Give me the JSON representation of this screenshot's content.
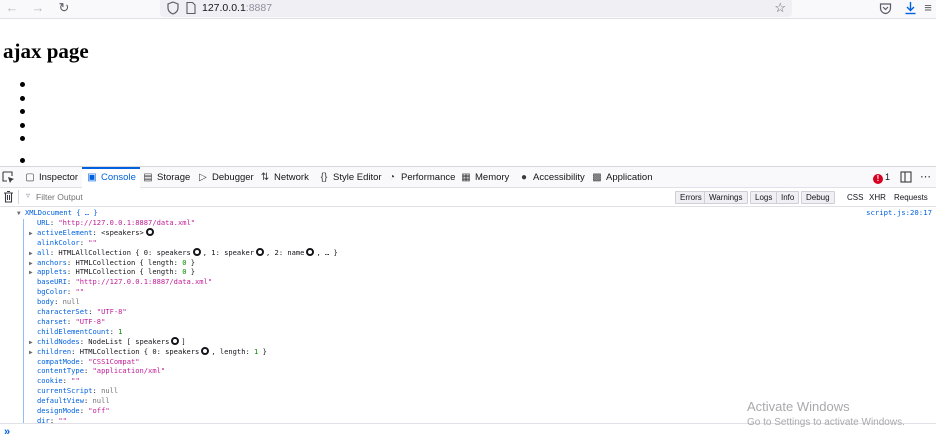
{
  "browser": {
    "url_host": "127.0.0.1",
    "url_port": ":8887"
  },
  "page": {
    "heading": "ajax page",
    "bullets": [
      "",
      "",
      "",
      "",
      "",
      "",
      ""
    ]
  },
  "devtools": {
    "tabs": [
      {
        "label": "Inspector",
        "icon": "inspector-icon"
      },
      {
        "label": "Console",
        "icon": "console-icon",
        "active": true
      },
      {
        "label": "Storage",
        "icon": "storage-icon"
      },
      {
        "label": "Debugger",
        "icon": "debugger-icon"
      },
      {
        "label": "Network",
        "icon": "network-icon"
      },
      {
        "label": "Style Editor",
        "icon": "style-editor-icon"
      },
      {
        "label": "Performance",
        "icon": "performance-icon"
      },
      {
        "label": "Memory",
        "icon": "memory-icon"
      },
      {
        "label": "Accessibility",
        "icon": "accessibility-icon"
      },
      {
        "label": "Application",
        "icon": "application-icon"
      }
    ],
    "error_count": "1",
    "filter_placeholder": "Filter Output",
    "filter_buttons": [
      "Errors",
      "Warnings",
      "Logs",
      "Info",
      "Debug"
    ],
    "filter_texts": [
      "CSS",
      "XHR",
      "Requests"
    ],
    "source_link": "script.js:20:17",
    "console_lines": [
      {
        "head": "XMLDocument { … }"
      },
      {
        "key": "URL",
        "str": "\"http://127.0.0.1:8887/data.xml\""
      },
      {
        "key": "activeElement",
        "tw": true,
        "plain": "<speakers>",
        "gear": true
      },
      {
        "key": "alinkColor",
        "str": "\"\""
      },
      {
        "key": "all",
        "tw": true,
        "plain": "HTMLAllCollection { 0: speakers",
        "gear": true,
        "plain2": ", 1: speaker",
        "gear2": true,
        "plain3": ", 2: name",
        "gear3": true,
        "plain4": ", … }"
      },
      {
        "key": "anchors",
        "tw": true,
        "plain": "HTMLCollection { length:",
        "num": "0",
        "plain2": "}"
      },
      {
        "key": "applets",
        "tw": true,
        "plain": "HTMLCollection { length:",
        "num": "0",
        "plain2": "}"
      },
      {
        "key": "baseURI",
        "str": "\"http://127.0.0.1:8887/data.xml\""
      },
      {
        "key": "bgColor",
        "str": "\"\""
      },
      {
        "key": "body",
        "nul": "null"
      },
      {
        "key": "characterSet",
        "str": "\"UTF-8\""
      },
      {
        "key": "charset",
        "str": "\"UTF-8\""
      },
      {
        "key": "childElementCount",
        "num": "1"
      },
      {
        "key": "childNodes",
        "tw": true,
        "plain": "NodeList [ speakers",
        "gear": true,
        "plain2": "]"
      },
      {
        "key": "children",
        "tw": true,
        "plain": "HTMLCollection { 0: speakers",
        "gear": true,
        "plain2": ", length:",
        "num2": "1",
        "plain3": "}"
      },
      {
        "key": "compatMode",
        "str": "\"CSS1Compat\""
      },
      {
        "key": "contentType",
        "str": "\"application/xml\""
      },
      {
        "key": "cookie",
        "str": "\"\""
      },
      {
        "key": "currentScript",
        "nul": "null"
      },
      {
        "key": "defaultView",
        "nul": "null"
      },
      {
        "key": "designMode",
        "str": "\"off\""
      },
      {
        "key": "dir",
        "str": "\"\""
      }
    ]
  },
  "watermark": {
    "title": "Activate Windows",
    "subtitle": "Go to Settings to activate Windows."
  }
}
